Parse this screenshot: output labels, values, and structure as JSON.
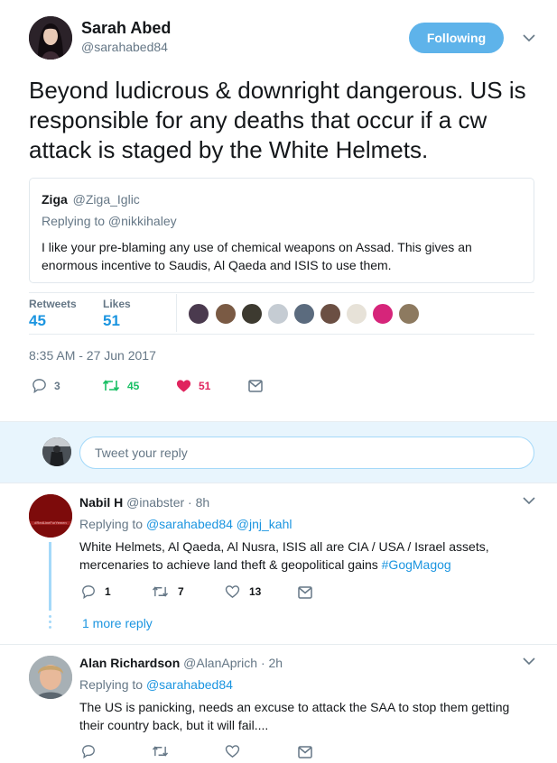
{
  "tweet": {
    "author_name": "Sarah Abed",
    "author_handle": "@sarahabed84",
    "follow_label": "Following",
    "text": "Beyond ludicrous & downright dangerous. US is responsible for any deaths that occur if a cw attack is staged by the White Helmets.",
    "quote": {
      "name": "Ziga",
      "handle": "@Ziga_Iglic",
      "replying_to": "Replying to @nikkihaley",
      "text": "I like your pre-blaming any use of chemical weapons on Assad. This gives an enormous incentive to Saudis, Al Qaeda and ISIS to use them."
    },
    "retweets_label": "Retweets",
    "retweets_count": "45",
    "likes_label": "Likes",
    "likes_count": "51",
    "timestamp": "8:35 AM - 27 Jun 2017",
    "actions": {
      "reply_count": "3",
      "retweet_count": "45",
      "like_count": "51"
    }
  },
  "reply_box": {
    "placeholder": "Tweet your reply"
  },
  "replies": [
    {
      "name": "Nabil H",
      "handle": "@inabster",
      "time": "· 8h",
      "replying_prefix": "Replying to",
      "replying_to": "@sarahabed84 @jnj_kahl",
      "text": "White Helmets, Al Qaeda, Al Nusra, ISIS all are CIA / USA / Israel assets, mercenaries to achieve land theft & geopolitical gains",
      "hashtag": "#GogMagog",
      "reply_count": "1",
      "retweet_count": "7",
      "like_count": "13",
      "more_replies": "1 more reply"
    },
    {
      "name": "Alan Richardson",
      "handle": "@AlanAprich",
      "time": "· 2h",
      "replying_prefix": "Replying to",
      "replying_to": "@sarahabed84",
      "text": "The US is panicking, needs an excuse to attack the SAA to stop them getting their country back, but it will fail...."
    }
  ],
  "colors": {
    "accent": "#1b95e0",
    "retweet_green": "#17bf63",
    "like_red": "#e0245e",
    "follow_button": "#5eb3ea",
    "reply_area_bg": "#e8f5fd"
  },
  "icons": [
    "chevron-down-icon",
    "reply-icon",
    "retweet-icon",
    "heart-icon",
    "message-icon"
  ]
}
